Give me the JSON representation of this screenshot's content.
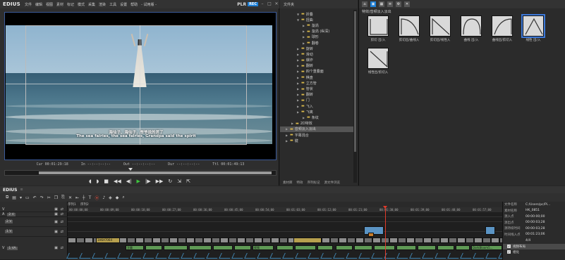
{
  "app": {
    "name": "EDIUS",
    "project_title": "- 试用版 -"
  },
  "menu": {
    "items": [
      "文件",
      "编辑",
      "视图",
      "素材",
      "标记",
      "模式",
      "采集",
      "渲染",
      "工具",
      "设置",
      "帮助"
    ]
  },
  "player": {
    "mode": "PLR",
    "rec": "REC",
    "subtitle_cn": "海仙子、海仙子，爷爷说的灵了",
    "subtitle_en": "The sea fairies, the sea fairies, Grandpa said the spirit",
    "timecodes": [
      {
        "label": "Cur",
        "value": "00:01:29:18"
      },
      {
        "label": "In",
        "value": "--:--:--:--"
      },
      {
        "label": "Out",
        "value": "--:--:--:--"
      },
      {
        "label": "Dur",
        "value": "--:--:--:--"
      },
      {
        "label": "Ttl",
        "value": "00:01:49:13"
      }
    ],
    "scrub_position": 0.33
  },
  "bin": {
    "header": "文件夹",
    "tree": [
      {
        "label": "折叠",
        "indent": 3,
        "expanded": true
      },
      {
        "label": "扭曲",
        "indent": 3,
        "expanded": true
      },
      {
        "label": "漩涡",
        "indent": 4
      },
      {
        "label": "漩涡 (纵深)",
        "indent": 4
      },
      {
        "label": "球形",
        "indent": 4
      },
      {
        "label": "翻卷",
        "indent": 4
      },
      {
        "label": "旋转",
        "indent": 3
      },
      {
        "label": "滑动",
        "indent": 3
      },
      {
        "label": "爆炸",
        "indent": 3
      },
      {
        "label": "翻转",
        "indent": 3
      },
      {
        "label": "四个重叠面",
        "indent": 3
      },
      {
        "label": "棋盘",
        "indent": 3
      },
      {
        "label": "立方管",
        "indent": 3
      },
      {
        "label": "管状",
        "indent": 3
      },
      {
        "label": "翻转",
        "indent": 3
      },
      {
        "label": "门",
        "indent": 3
      },
      {
        "label": "飞入",
        "indent": 3
      },
      {
        "label": "飞离",
        "indent": 3
      },
      {
        "label": "条纹",
        "indent": 4
      },
      {
        "label": "2D特效",
        "indent": 2
      },
      {
        "label": "音频淡入淡出",
        "indent": 1,
        "selected": true
      },
      {
        "label": "字幕混合",
        "indent": 1
      },
      {
        "label": "键",
        "indent": 1
      }
    ],
    "tabs": [
      "素材库",
      "特效",
      "序列标记",
      "源文件浏览"
    ]
  },
  "effects": {
    "path": "特效/音频淡入淡出",
    "items": [
      {
        "label": "剪切 出/入",
        "curve": "cut"
      },
      {
        "label": "剪切出/曲线入",
        "curve": "cut-curve"
      },
      {
        "label": "剪切出/线性入",
        "curve": "cut-linear"
      },
      {
        "label": "曲线 出/入",
        "curve": "curve"
      },
      {
        "label": "曲线出/剪切入",
        "curve": "curve-cut"
      },
      {
        "label": "线性 出/入",
        "curve": "linear",
        "selected": true
      },
      {
        "label": "线性出/剪切入",
        "curve": "linear-cut"
      }
    ]
  },
  "timeline": {
    "title": "EDIUS",
    "sequence_tabs": [
      "序列1",
      "序列2"
    ],
    "ruler": [
      "00:00:00;00",
      "00:00:09;00",
      "00:00:18;00",
      "00:00:27;00",
      "00:00:36;00",
      "00:00:45;00",
      "00:00:54;00",
      "00:01:03;00",
      "00:01:12;00",
      "00:01:21;00",
      "00:01:30;00",
      "00:01:39;00",
      "00:01:48;00",
      "00:01:57;00"
    ],
    "tracks": [
      {
        "name": "V",
        "label": "",
        "kind": "v"
      },
      {
        "name": "A",
        "label": "2 V",
        "kind": "v"
      },
      {
        "name": "",
        "label": "2 V",
        "kind": "v"
      },
      {
        "name": "",
        "label": "1 V",
        "kind": "v"
      },
      {
        "name": "V",
        "label": "1 VA",
        "kind": "va"
      }
    ],
    "clip_texts": [
      "1H6A7064",
      "字幕",
      "视频",
      "DarkBloom5..."
    ]
  },
  "info": {
    "rows": [
      {
        "k": "文件名称",
        "v": "C:/Users/pc/Pi..."
      },
      {
        "k": "素材名称",
        "v": "HK_0851"
      },
      {
        "k": "源入点",
        "v": "00:00:00;00"
      },
      {
        "k": "源出点",
        "v": "00:00:03;28"
      },
      {
        "k": "源持续时间",
        "v": "00:00:03;28"
      },
      {
        "k": "时间线入点",
        "v": "00:01:23;06"
      },
      {
        "k": "",
        "v": "4/4"
      }
    ],
    "effects": [
      {
        "label": "视频布局",
        "selected": true
      },
      {
        "label": "组化",
        "selected": false
      }
    ]
  },
  "colors": {
    "accent": "#1d7fd6",
    "playhead": "#e03a2a",
    "clip_green": "#5f9a55",
    "clip_yellow": "#b7a04e",
    "clip_blue": "#5b94c4"
  }
}
